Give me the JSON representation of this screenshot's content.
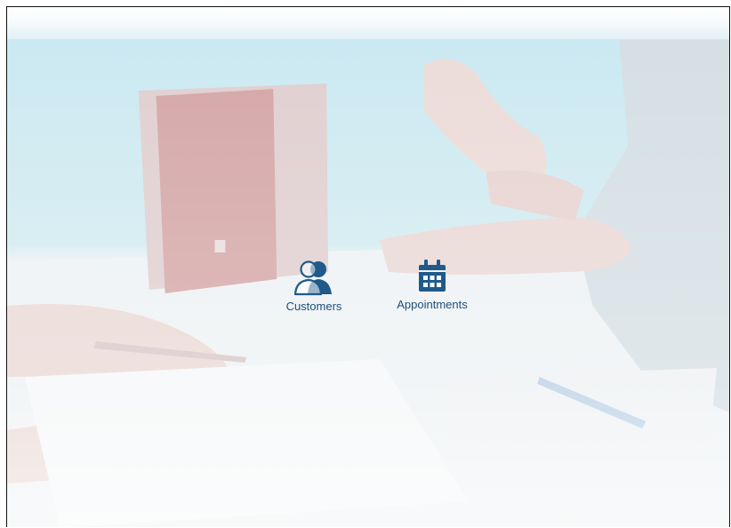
{
  "apps": [
    {
      "label": "Customers",
      "icon": "customers-icon"
    },
    {
      "label": "Appointments",
      "icon": "calendar-icon"
    }
  ],
  "colors": {
    "icon": "#1f5a8a",
    "label": "#1d4f78",
    "topbar": "#e6f2f8"
  }
}
